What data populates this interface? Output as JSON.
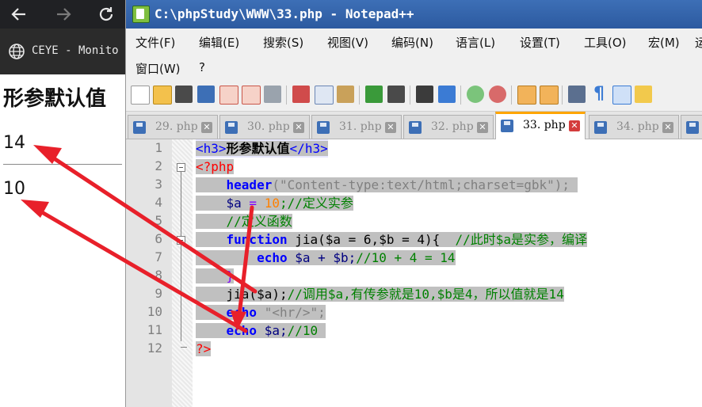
{
  "browser": {
    "tab_title": "CEYE - Monito",
    "page_heading": "形参默认值",
    "output_first": "14",
    "output_second": "10"
  },
  "notepad": {
    "window_title": "C:\\phpStudy\\WWW\\33.php - Notepad++",
    "menu": [
      "文件(F)",
      "编辑(E)",
      "搜索(S)",
      "视图(V)",
      "编码(N)",
      "语言(L)",
      "设置(T)",
      "工具(O)",
      "宏(M)",
      "运",
      "窗口(W)",
      "?"
    ],
    "tabs": [
      {
        "label": "29. php",
        "active": false
      },
      {
        "label": "30. php",
        "active": false
      },
      {
        "label": "31. php",
        "active": false
      },
      {
        "label": "32. php",
        "active": false
      },
      {
        "label": "33. php",
        "active": true
      },
      {
        "label": "34. php",
        "active": false
      }
    ],
    "line_numbers": [
      "1",
      "2",
      "3",
      "4",
      "5",
      "6",
      "7",
      "8",
      "9",
      "10",
      "11",
      "12"
    ],
    "code": {
      "l1_tag_open": "<h3>",
      "l1_text": "形参默认值",
      "l1_tag_close": "</h3>",
      "l2": "<?php",
      "l3_fn": "header",
      "l3_str": "(\"Content-type:text/html;charset=gbk\");",
      "l4_var": "$a",
      "l4_eq": " = ",
      "l4_num": "10",
      "l4_cm": ";//定义实参",
      "l5_cm": "//定义函数",
      "l6_kw": "function",
      "l6_rest": " jia($a = 6,$b = 4){",
      "l6_cm": "  //此时$a是实参，编译",
      "l7_kw": "echo",
      "l7_rest": " $a + $b;",
      "l7_cm": "//10 + 4 = 14",
      "l8": "}",
      "l9_rest": "jia($a);",
      "l9_cm": "//调用$a,有传参就是10,$b是4，所以值就是14",
      "l10_kw": "echo",
      "l10_str": " \"<hr/>\";",
      "l11_kw": "echo",
      "l11_rest": " $a;",
      "l11_cm": "//10",
      "l12": "?>"
    }
  },
  "annotation_color": "#e8202a"
}
